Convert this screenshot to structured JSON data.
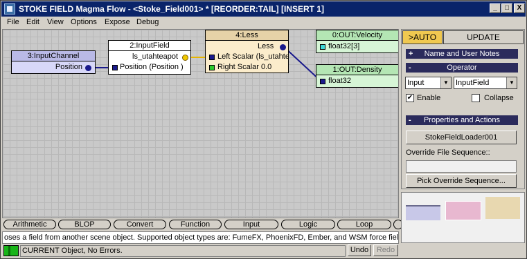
{
  "window": {
    "title": "STOKE FIELD Magma Flow - <Stoke_Field001> *  [REORDER:TAIL] [INSERT 1]",
    "min_glyph": "_",
    "max_glyph": "□",
    "close_glyph": "X"
  },
  "menu": [
    "File",
    "Edit",
    "View",
    "Options",
    "Expose",
    "Debug"
  ],
  "nodes": {
    "input_channel": {
      "title": "3:InputChannel",
      "output": "Position"
    },
    "input_field": {
      "title": "2:InputField",
      "field_name": "ls_utahteapot",
      "input": "Position (Position )"
    },
    "less": {
      "title": "4:Less",
      "output": "Less",
      "left": "Left Scalar (ls_utahte",
      "right": "Right Scalar 0.0"
    },
    "out_velocity": {
      "title": "0:OUT:Velocity",
      "type": "float32[3]"
    },
    "out_density": {
      "title": "1:OUT:Density",
      "type": "float32"
    }
  },
  "categories": [
    "Arithmetic",
    "BLOP",
    "Convert",
    "Function",
    "Input",
    "Logic",
    "Loop"
  ],
  "status_message": "oses a field from another scene object. Supported object types are: FumeFX, PhoenixFD, Ember, and WSM force fields.",
  "bottom": {
    "state": "CURRENT Object, No Errors.",
    "undo": "Undo",
    "redo": "Redo"
  },
  "panel": {
    "tab_auto": ">AUTO",
    "tab_update": "UPDATE",
    "rollout_name": "Name and User Notes",
    "rollout_operator": "Operator",
    "category_value": "Input",
    "operator_value": "InputField",
    "enable_label": "Enable",
    "collapse_label": "Collapse",
    "enable_checked": true,
    "collapse_checked": false,
    "rollout_props": "Properties and Actions",
    "object_button": "StokeFieldLoader001",
    "override_label": "Override File Sequence::",
    "override_value": "",
    "pick_button": "Pick Override Sequence...",
    "sign_plus": "+",
    "sign_minus": "-"
  },
  "colors": {
    "titlebar": "#0a246a",
    "input_channel_header": "#b9b9e6",
    "input_channel_body": "#d8d8f8",
    "less_header": "#e6d2a8",
    "less_body": "#fbeccb",
    "output_header": "#b4e6b4",
    "output_body": "#d6f5d6",
    "wire_orange": "#e6b400",
    "wire_blue": "#1a1a8c",
    "preview_blue": "#c8c8e8",
    "preview_pink": "#e8b8d0",
    "preview_tan": "#e8d8b0"
  }
}
